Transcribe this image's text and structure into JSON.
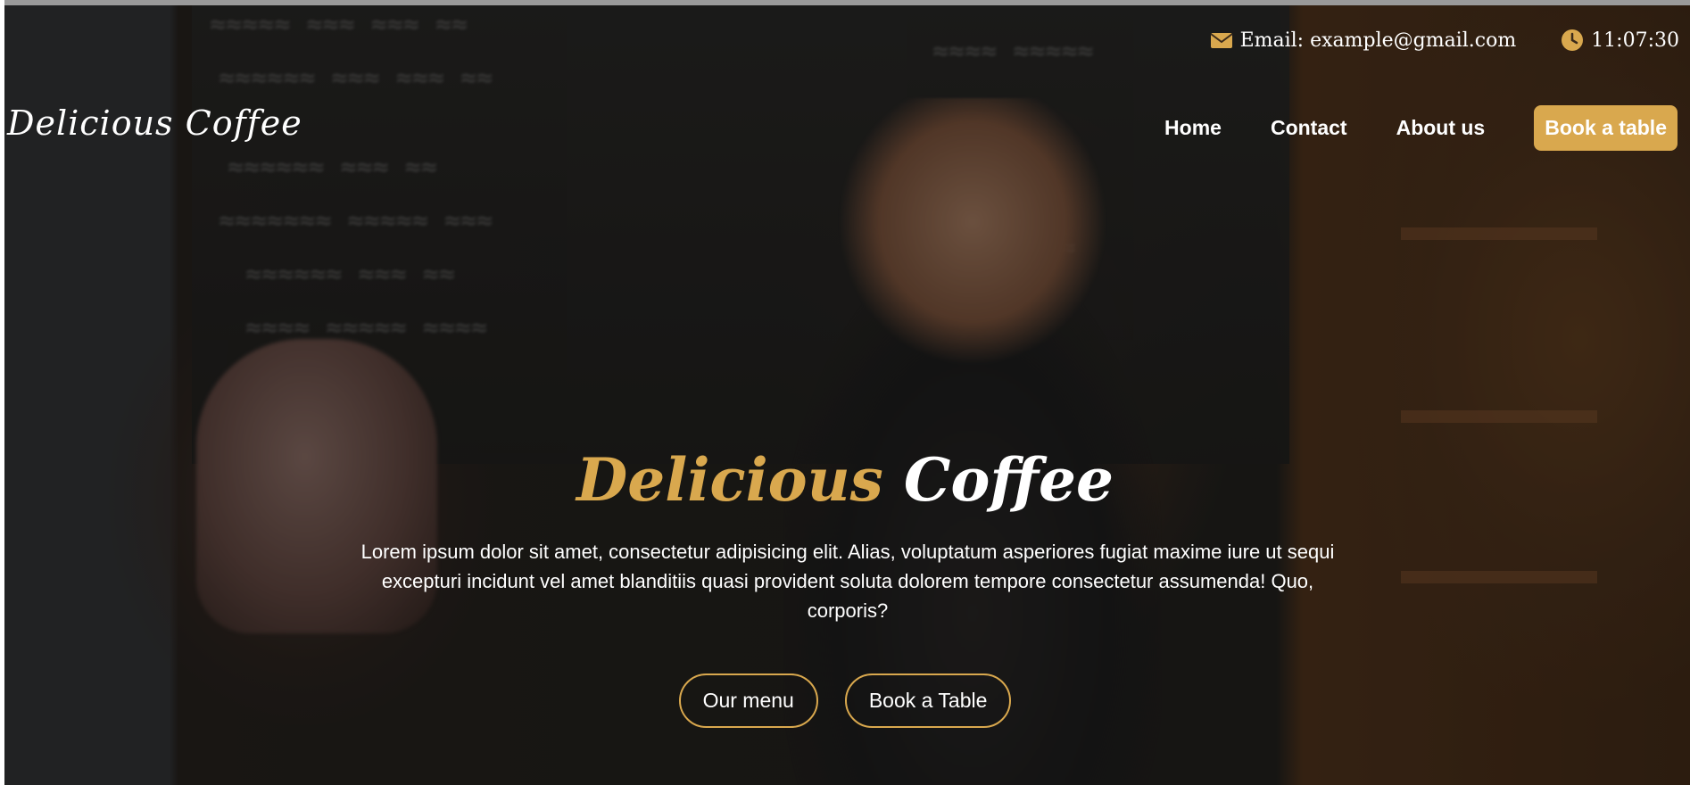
{
  "topbar": {
    "email_text": "Email: example@gmail.com",
    "time_text": "11:07:30",
    "email_icon": "envelope-icon",
    "clock_icon": "clock-icon"
  },
  "brand": {
    "logo_text": "Delicious Coffee"
  },
  "nav": {
    "items": [
      {
        "label": "Home"
      },
      {
        "label": "Contact"
      },
      {
        "label": "About us"
      }
    ],
    "cta_label": "Book a table"
  },
  "hero": {
    "title_part1": "Delicious",
    "title_part2": "Coffee",
    "description": "Lorem ipsum dolor sit amet, consectetur adipisicing elit. Alias, voluptatum asperiores fugiat maxime iure ut sequi excepturi incidunt vel amet blanditiis quasi provident soluta dolorem tempore consectetur assumenda! Quo, corporis?",
    "primary_button": "Our menu",
    "secondary_button": "Book a Table"
  },
  "colors": {
    "accent": "#d9a84e",
    "text": "#ffffff"
  }
}
